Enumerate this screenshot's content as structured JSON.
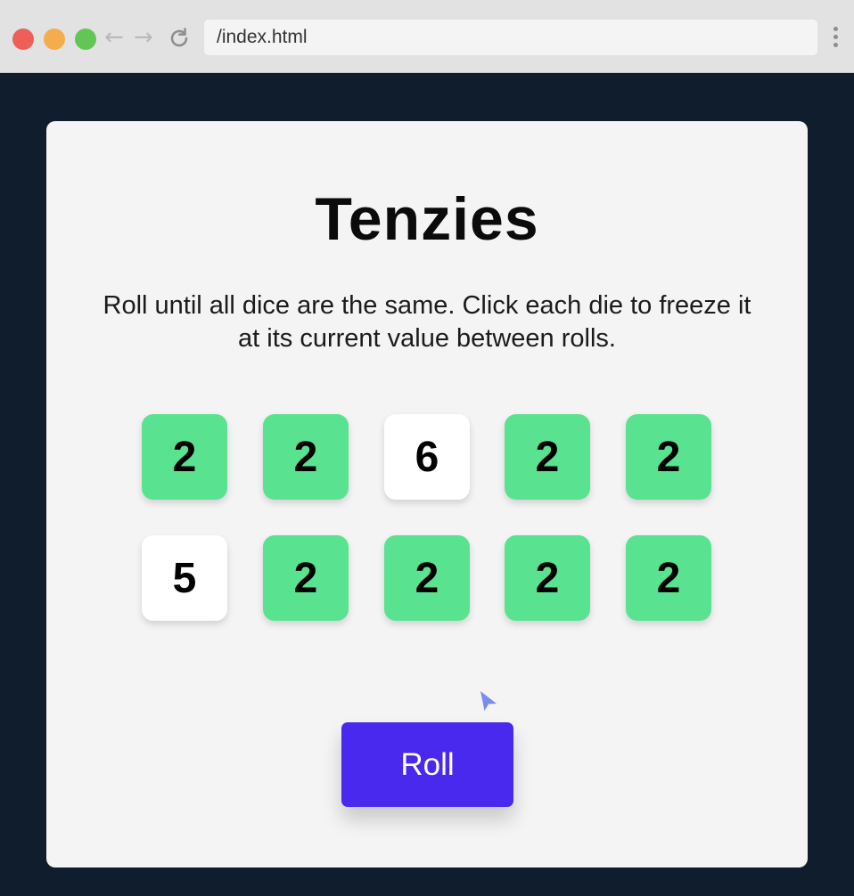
{
  "browser": {
    "address": "/index.html",
    "icons": [
      "close-light",
      "minimize-light",
      "maximize-light",
      "back-arrow-icon",
      "forward-arrow-icon",
      "reload-icon",
      "kebab-menu-icon"
    ],
    "back_glyph": "←",
    "forward_glyph": "→"
  },
  "app": {
    "title": "Tenzies",
    "instructions": "Roll until all dice are the same. Click each die to freeze it at its current value between rolls.",
    "dice": [
      {
        "value": "2",
        "held": true
      },
      {
        "value": "2",
        "held": true
      },
      {
        "value": "6",
        "held": false
      },
      {
        "value": "2",
        "held": true
      },
      {
        "value": "2",
        "held": true
      },
      {
        "value": "5",
        "held": false
      },
      {
        "value": "2",
        "held": true
      },
      {
        "value": "2",
        "held": true
      },
      {
        "value": "2",
        "held": true
      },
      {
        "value": "2",
        "held": true
      }
    ],
    "roll_label": "Roll"
  },
  "colors": {
    "page_background": "#0f1d2c",
    "card_background": "#f4f4f4",
    "held_die": "#59e391",
    "free_die": "#ffffff",
    "roll_button": "#4a29ee",
    "cursor": "#7b8cf0"
  }
}
